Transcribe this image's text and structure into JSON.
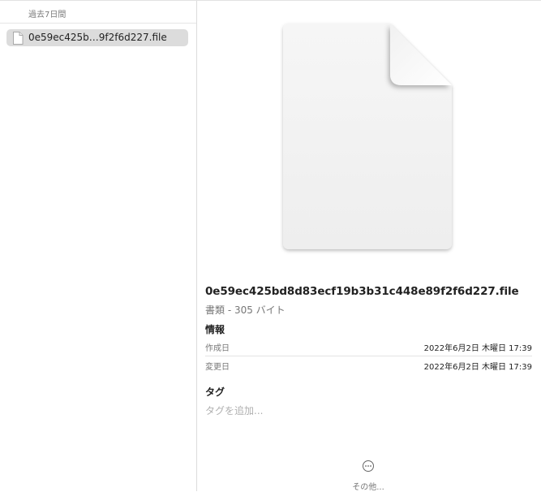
{
  "sidebar": {
    "section_header": "過去7日間",
    "items": [
      {
        "label": "0e59ec425b…9f2f6d227.file",
        "icon": "document-icon",
        "selected": true
      }
    ]
  },
  "detail": {
    "file_name": "0e59ec425bd8d83ecf19b3b31c448e89f2f6d227.file",
    "subtitle": "書類 - 305 バイト",
    "info_title": "情報",
    "info_rows": [
      {
        "label": "作成日",
        "value": "2022年6月2日 木曜日 17:39"
      },
      {
        "label": "変更日",
        "value": "2022年6月2日 木曜日 17:39"
      }
    ],
    "tags_title": "タグ",
    "tags_placeholder": "タグを追加...",
    "more_label": "その他...",
    "more_icon": "ellipsis-circle-icon"
  },
  "colors": {
    "selection": "#dcdcdc",
    "divider": "#e4e4e4",
    "secondary_text": "#777777",
    "placeholder_text": "#b0b0b0"
  }
}
